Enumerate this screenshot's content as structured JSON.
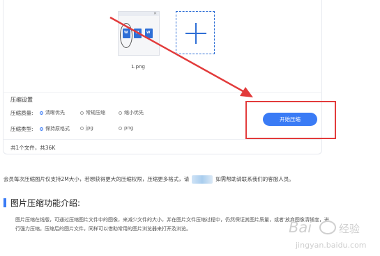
{
  "upload": {
    "file_name": "1.png",
    "thumbnail_icons": [
      "document-icon",
      "document-icon",
      "document-icon"
    ]
  },
  "settings": {
    "title": "压缩设置",
    "quality_label": "压缩质量:",
    "quality_options": [
      "清晰优先",
      "常规压缩",
      "缩小优先"
    ],
    "quality_selected": "清晰优先",
    "type_label": "压缩类型:",
    "type_options": [
      "保持原格式",
      "jpg",
      "png"
    ],
    "type_selected": "保持原格式",
    "start_button": "开始压缩"
  },
  "summary": {
    "file_count": "共1个文件，共36K"
  },
  "member_note": {
    "before": "会员每次压缩图片仅支持2M大小，若想获得更大的压缩权限，压缩更多格式，请",
    "after": "如需帮助请联系我们的客服人员。"
  },
  "intro": {
    "title": "图片压缩功能介绍:",
    "text": "图片压缩在线版，可通过压缩图片文件中的图像，来减少文件的大小，并在图片文件压缩过程中，仍然保证其图片质量，或者'放弃图像清晰度，进行强力压缩。压缩后的图片文件，同样可以借助常用的图片浏览器来打开及浏览。"
  },
  "colors": {
    "accent": "#3a7bf5",
    "annotation_red": "#e23b3b"
  }
}
